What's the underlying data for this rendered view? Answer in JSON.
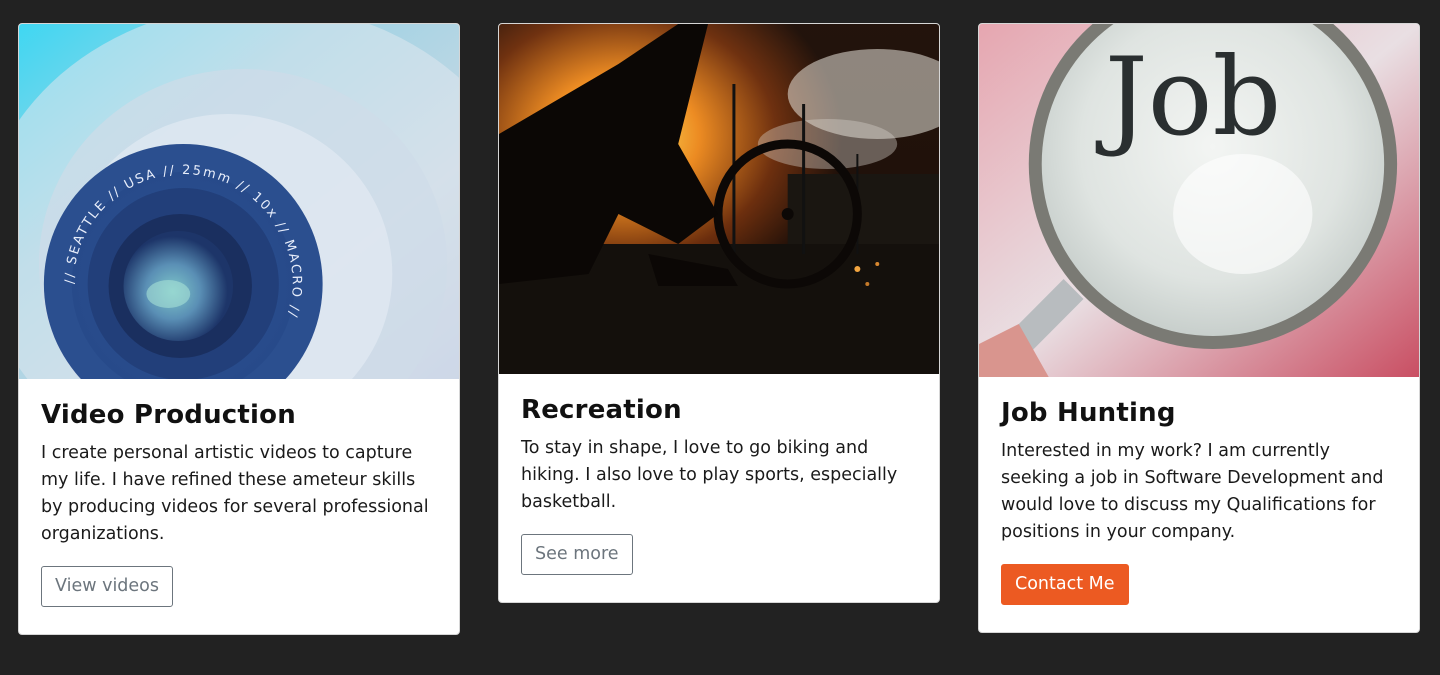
{
  "colors": {
    "page_background": "#222222",
    "card_background": "#ffffff",
    "accent": "#ec5a22",
    "outline_button": "#6c757d"
  },
  "cards": [
    {
      "image_subject": "camera lens",
      "title": "Video Production",
      "text": "I create personal artistic videos to capture my life. I have refined these ameteur skills by producing videos for several professional organizations.",
      "button_label": "View videos",
      "lens_ring_text": "// SEATTLE // USA // 25mm // 10x // MACRO //"
    },
    {
      "image_subject": "bike at sunset",
      "title": "Recreation",
      "text": "To stay in shape, I love to go biking and hiking. I also love to play sports, especially basketball.",
      "button_label": "See more"
    },
    {
      "image_subject": "magnifying glass",
      "title": "Job Hunting",
      "text": "Interested in my work? I am currently seeking a job in Software Development and would love to discuss my Qualifications for positions in your company.",
      "button_label": "Contact Me",
      "image_text": "Job"
    }
  ]
}
